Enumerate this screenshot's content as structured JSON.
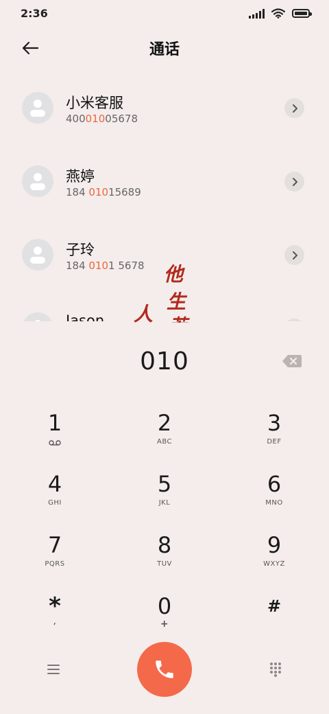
{
  "status_bar": {
    "time": "2:36"
  },
  "header": {
    "title": "通话"
  },
  "contacts": [
    {
      "name": "小米客服",
      "number_pre": "400",
      "number_match": "010",
      "number_post": "05678"
    },
    {
      "name": "燕婷",
      "number_pre": "184 ",
      "number_match": "010",
      "number_post": "15689"
    },
    {
      "name": "子玲",
      "number_pre": "184 ",
      "number_match": "010",
      "number_post": "1 5678"
    },
    {
      "name": "Jason"
    }
  ],
  "dialer": {
    "value": "010"
  },
  "keys": [
    {
      "digit": "1",
      "letters": ""
    },
    {
      "digit": "2",
      "letters": "ABC"
    },
    {
      "digit": "3",
      "letters": "DEF"
    },
    {
      "digit": "4",
      "letters": "GHI"
    },
    {
      "digit": "5",
      "letters": "JKL"
    },
    {
      "digit": "6",
      "letters": "MNO"
    },
    {
      "digit": "7",
      "letters": "PQRS"
    },
    {
      "digit": "8",
      "letters": "TUV"
    },
    {
      "digit": "9",
      "letters": "WXYZ"
    },
    {
      "digit": "*",
      "letters": ","
    },
    {
      "digit": "0",
      "letters": "+"
    },
    {
      "digit": "#",
      "letters": ""
    }
  ],
  "watermark": {
    "chars": [
      "他",
      "生",
      "人",
      "若"
    ]
  },
  "icons": {
    "back": "arrow-left-icon",
    "detail": "chevron-right-icon",
    "backspace": "backspace-icon",
    "voicemail": "voicemail-icon",
    "menu": "menu-icon",
    "call": "phone-icon",
    "keypad": "dialpad-icon"
  },
  "colors": {
    "accent": "#f4694a",
    "highlight": "#e8673f",
    "background": "#f4edeb"
  }
}
